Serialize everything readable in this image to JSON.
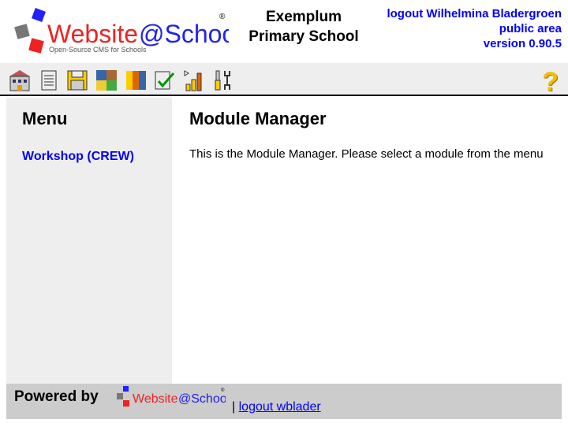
{
  "header": {
    "logo_text": "Website@School",
    "logo_tagline": "Open-Source CMS for Schools",
    "site_title_line1": "Exemplum",
    "site_title_line2": "Primary School",
    "logout_link": "logout Wilhelmina Bladergroen",
    "public_area_link": "public area",
    "version": "version 0.90.5"
  },
  "toolbar": {
    "icons": [
      "area-icon",
      "page-icon",
      "backup-icon",
      "modules-icon",
      "users-icon",
      "configuration-icon",
      "statistics-icon",
      "tools-icon"
    ],
    "help": "?"
  },
  "menu": {
    "title": "Menu",
    "items": [
      {
        "label": "Workshop (CREW)"
      }
    ]
  },
  "main": {
    "title": "Module Manager",
    "text": "This is the Module Manager. Please select a module from the menu"
  },
  "footer": {
    "powered_by": "Powered by",
    "separator": "|",
    "logout_link": "logout wblader"
  },
  "colors": {
    "link": "#0000ff",
    "sidebar": "#eeeeee",
    "footer": "#cccccc"
  }
}
